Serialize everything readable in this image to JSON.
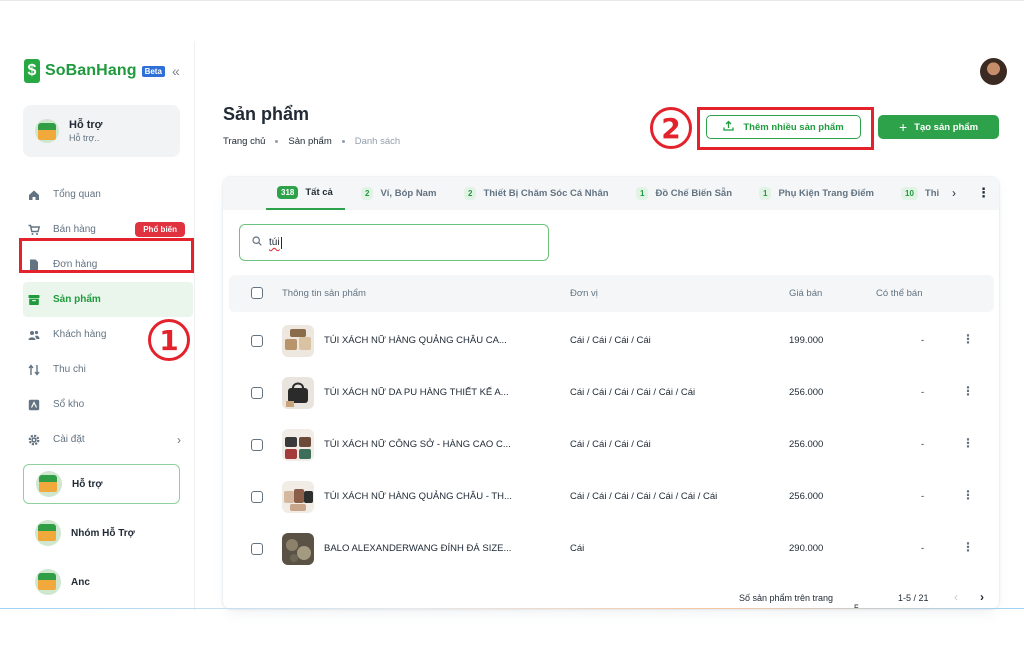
{
  "brand": {
    "name": "SoBanHang",
    "badge": "Beta"
  },
  "account": {
    "name": "Hỗ trợ",
    "subtitle": "Hỗ trợ.."
  },
  "nav": [
    {
      "label": "Tổng quan",
      "icon": "home-icon"
    },
    {
      "label": "Bán hàng",
      "icon": "cart-icon",
      "badge": "Phổ biến"
    },
    {
      "label": "Đơn hàng",
      "icon": "document-icon"
    },
    {
      "label": "Sản phẩm",
      "icon": "box-icon",
      "active": true
    },
    {
      "label": "Khách hàng",
      "icon": "users-icon"
    },
    {
      "label": "Thu chi",
      "icon": "transfer-icon"
    },
    {
      "label": "Sổ kho",
      "icon": "warehouse-icon"
    },
    {
      "label": "Cài đặt",
      "icon": "gear-icon"
    }
  ],
  "teams": [
    {
      "label": "Hỗ trợ",
      "selected": true
    },
    {
      "label": "Nhóm Hỗ Trợ"
    },
    {
      "label": "Anc"
    }
  ],
  "annotations": {
    "step1": "1",
    "step2": "2",
    "color": "#e4222b"
  },
  "page": {
    "title": "Sản phẩm",
    "breadcrumb": [
      "Trang chủ",
      "Sản phẩm",
      "Danh sách"
    ]
  },
  "actions": {
    "bulk_add": "Thêm nhiều sản phẩm",
    "create": "Tạo sản phẩm"
  },
  "tabs": [
    {
      "count": "318",
      "label": "Tất cả",
      "active": true
    },
    {
      "count": "2",
      "label": "Ví, Bóp Nam"
    },
    {
      "count": "2",
      "label": "Thiết Bị Chăm Sóc Cá Nhân"
    },
    {
      "count": "1",
      "label": "Đồ Chế Biến Sẵn"
    },
    {
      "count": "1",
      "label": "Phụ Kiện Trang Điểm"
    },
    {
      "count": "10",
      "label": "Thi"
    }
  ],
  "search": {
    "value": "túi"
  },
  "table": {
    "columns": [
      "Thông tin sản phẩm",
      "Đơn vị",
      "Giá bán",
      "Có thể bán"
    ],
    "rows": [
      {
        "name": "TÚI XÁCH NỮ HÀNG QUẢNG CHÂU CA...",
        "unit": "Cái / Cái / Cái / Cái",
        "price": "199.000",
        "available": "-"
      },
      {
        "name": "TÚI XÁCH NỮ DA PU HÀNG THIẾT KẾ A...",
        "unit": "Cái / Cái / Cái / Cái / Cái / Cái",
        "price": "256.000",
        "available": "-"
      },
      {
        "name": "TÚI XÁCH NỮ CÔNG SỞ - HÀNG CAO C...",
        "unit": "Cái / Cái / Cái / Cái",
        "price": "256.000",
        "available": "-"
      },
      {
        "name": "TÚI XÁCH NỮ HÀNG QUẢNG CHÂU - TH...",
        "unit": "Cái / Cái / Cái / Cái / Cái / Cái / Cái",
        "price": "256.000",
        "available": "-"
      },
      {
        "name": "BALO ALEXANDERWANG ĐÍNH ĐÁ SIZE...",
        "unit": "Cái",
        "price": "290.000",
        "available": "-"
      }
    ]
  },
  "pagination": {
    "rows_label": "Số sản phẩm trên trang",
    "per_page": "5",
    "range": "1-5 / 21"
  },
  "colors": {
    "brand_green": "#2ea24a",
    "danger": "#e0323f",
    "annotation_red": "#e4222b"
  }
}
